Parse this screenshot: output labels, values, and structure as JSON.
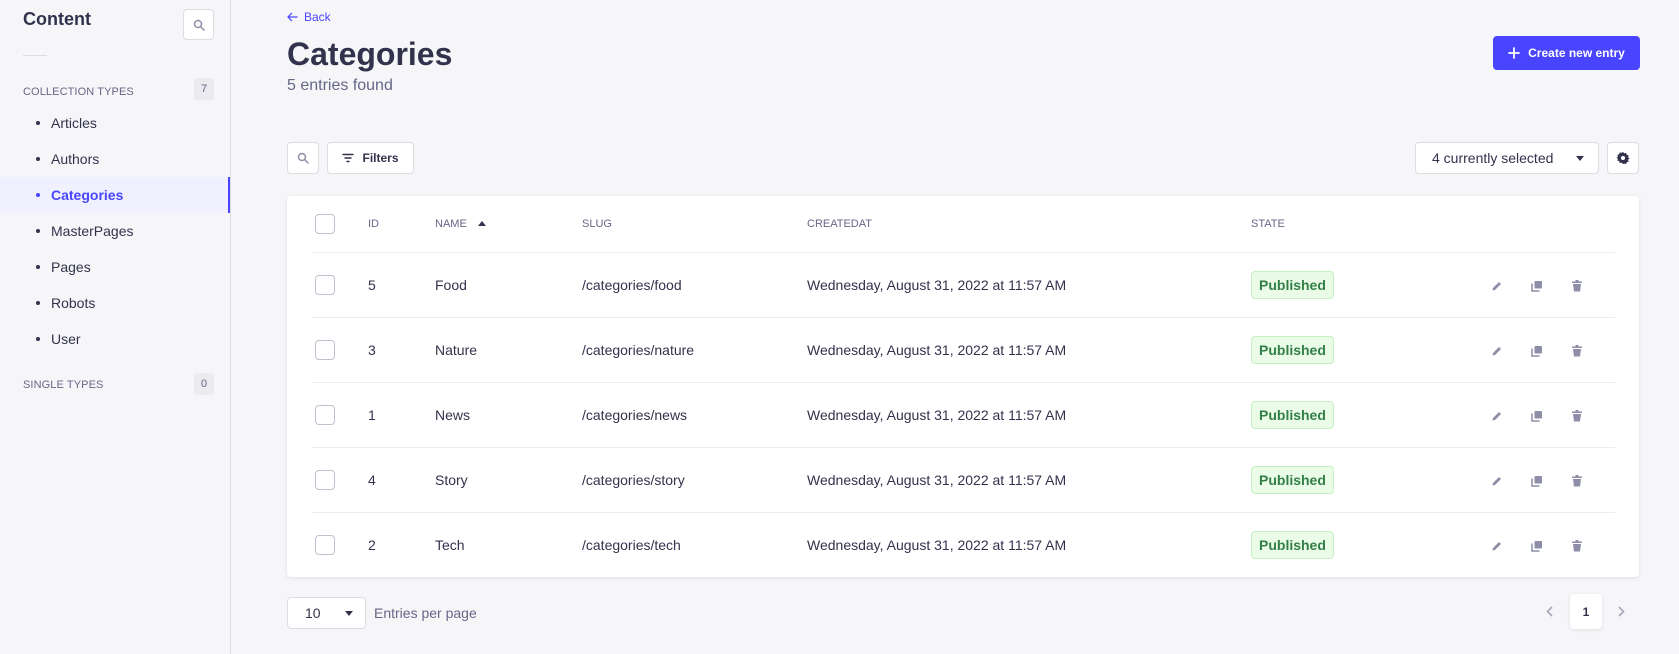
{
  "sidebar": {
    "title": "Content",
    "collection_types": {
      "label": "COLLECTION TYPES",
      "count": "7"
    },
    "items": [
      {
        "label": "Articles",
        "active": false
      },
      {
        "label": "Authors",
        "active": false
      },
      {
        "label": "Categories",
        "active": true
      },
      {
        "label": "MasterPages",
        "active": false
      },
      {
        "label": "Pages",
        "active": false
      },
      {
        "label": "Robots",
        "active": false
      },
      {
        "label": "User",
        "active": false
      }
    ],
    "single_types": {
      "label": "SINGLE TYPES",
      "count": "0"
    }
  },
  "header": {
    "back_label": "Back",
    "title": "Categories",
    "subtitle": "5 entries found",
    "create_label": "Create new entry"
  },
  "toolbar": {
    "filters_label": "Filters",
    "columns_select": "4 currently selected"
  },
  "table": {
    "headers": {
      "id": "ID",
      "name": "NAME",
      "slug": "SLUG",
      "created": "CREATEDAT",
      "state": "STATE"
    },
    "sort": {
      "column": "name",
      "direction": "ascending"
    },
    "rows": [
      {
        "id": "5",
        "name": "Food",
        "slug": "/categories/food",
        "created": "Wednesday, August 31, 2022 at 11:57 AM",
        "state": "Published"
      },
      {
        "id": "3",
        "name": "Nature",
        "slug": "/categories/nature",
        "created": "Wednesday, August 31, 2022 at 11:57 AM",
        "state": "Published"
      },
      {
        "id": "1",
        "name": "News",
        "slug": "/categories/news",
        "created": "Wednesday, August 31, 2022 at 11:57 AM",
        "state": "Published"
      },
      {
        "id": "4",
        "name": "Story",
        "slug": "/categories/story",
        "created": "Wednesday, August 31, 2022 at 11:57 AM",
        "state": "Published"
      },
      {
        "id": "2",
        "name": "Tech",
        "slug": "/categories/tech",
        "created": "Wednesday, August 31, 2022 at 11:57 AM",
        "state": "Published"
      }
    ],
    "row_actions": [
      "pencil-icon",
      "duplicate-icon",
      "trash-icon"
    ]
  },
  "footer": {
    "page_size": "10",
    "page_size_label": "Entries per page",
    "current_page": "1"
  },
  "colors": {
    "primary": "#4945ff",
    "text": "#32324d",
    "muted": "#666687",
    "published_bg": "#eafbe7",
    "published_text": "#328048"
  }
}
